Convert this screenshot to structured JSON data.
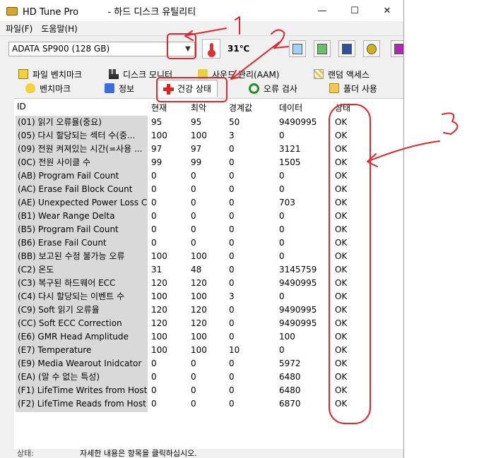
{
  "window": {
    "app_name": "HD Tune Pro",
    "subtitle": "- 하드 디스크 유틸리티",
    "minimize": "—",
    "maximize": "☐",
    "close": "✕"
  },
  "menu": [
    "파일(F)",
    "도움말(H)"
  ],
  "toolbar": {
    "drive": "ADATA SP900 (128 GB)",
    "temperature": "31℃"
  },
  "tabs_top": [
    "파일 벤치마크",
    "디스크 모니터",
    "사운드 관리(AAM)",
    "랜덤 액세스"
  ],
  "tabs_bottom": [
    "벤치마크",
    "정보",
    "건강 상태",
    "오류 검사",
    "폴더 사용"
  ],
  "columns": [
    "ID",
    "현재",
    "최악",
    "경계값",
    "데이터",
    "상태"
  ],
  "rows": [
    {
      "id": "(01) 읽기 오류율(중요)",
      "cur": "95",
      "worst": "95",
      "thr": "50",
      "data": "9490995",
      "status": "OK"
    },
    {
      "id": "(05) 다시 할당되는 섹터 수(중...",
      "cur": "100",
      "worst": "100",
      "thr": "3",
      "data": "0",
      "status": "OK"
    },
    {
      "id": "(09) 전원 켜져있는 시간(=사용 ...",
      "cur": "97",
      "worst": "97",
      "thr": "0",
      "data": "3121",
      "status": "OK"
    },
    {
      "id": "(0C) 전원 사이클 수",
      "cur": "99",
      "worst": "99",
      "thr": "0",
      "data": "1505",
      "status": "OK"
    },
    {
      "id": "(AB) Program Fail Count",
      "cur": "0",
      "worst": "0",
      "thr": "0",
      "data": "0",
      "status": "OK"
    },
    {
      "id": "(AC) Erase Fail Block Count",
      "cur": "0",
      "worst": "0",
      "thr": "0",
      "data": "0",
      "status": "OK"
    },
    {
      "id": "(AE) Unexpected Power Loss Co...",
      "cur": "0",
      "worst": "0",
      "thr": "0",
      "data": "703",
      "status": "OK"
    },
    {
      "id": "(B1) Wear Range Delta",
      "cur": "0",
      "worst": "0",
      "thr": "0",
      "data": "0",
      "status": "OK"
    },
    {
      "id": "(B5) Program Fail Count",
      "cur": "0",
      "worst": "0",
      "thr": "0",
      "data": "0",
      "status": "OK"
    },
    {
      "id": "(B6) Erase Fail Count",
      "cur": "0",
      "worst": "0",
      "thr": "0",
      "data": "0",
      "status": "OK"
    },
    {
      "id": "(BB) 보고된 수정 불가능 오류",
      "cur": "100",
      "worst": "100",
      "thr": "0",
      "data": "0",
      "status": "OK"
    },
    {
      "id": "(C2) 온도",
      "cur": "31",
      "worst": "48",
      "thr": "0",
      "data": "3145759",
      "status": "OK"
    },
    {
      "id": "(C3) 복구된 하드웨어 ECC",
      "cur": "120",
      "worst": "120",
      "thr": "0",
      "data": "9490995",
      "status": "OK"
    },
    {
      "id": "(C4) 다시 할당되는 이벤트 수",
      "cur": "100",
      "worst": "100",
      "thr": "3",
      "data": "0",
      "status": "OK"
    },
    {
      "id": "(C9) Soft 읽기 오류율",
      "cur": "120",
      "worst": "120",
      "thr": "0",
      "data": "9490995",
      "status": "OK"
    },
    {
      "id": "(CC) Soft ECC Correction",
      "cur": "120",
      "worst": "120",
      "thr": "0",
      "data": "9490995",
      "status": "OK"
    },
    {
      "id": "(E6) GMR Head Amplitude",
      "cur": "100",
      "worst": "100",
      "thr": "0",
      "data": "100",
      "status": "OK"
    },
    {
      "id": "(E7) Temperature",
      "cur": "100",
      "worst": "100",
      "thr": "10",
      "data": "0",
      "status": "OK"
    },
    {
      "id": "(E9) Media Wearout Inidcator",
      "cur": "0",
      "worst": "0",
      "thr": "0",
      "data": "5972",
      "status": "OK"
    },
    {
      "id": "(EA) (알 수 없는 특성)",
      "cur": "0",
      "worst": "0",
      "thr": "0",
      "data": "6480",
      "status": "OK"
    },
    {
      "id": "(F1) LifeTime Writes from Host",
      "cur": "0",
      "worst": "0",
      "thr": "0",
      "data": "6480",
      "status": "OK"
    },
    {
      "id": "(F2) LifeTime Reads from Host",
      "cur": "0",
      "worst": "0",
      "thr": "0",
      "data": "6870",
      "status": "OK"
    }
  ],
  "statusbar": {
    "label": "상태:",
    "message": "자세한 내용은 항목을 클릭하십시오."
  },
  "annotations": {
    "color": "#e0262f",
    "marks": [
      "1",
      "2",
      "3"
    ]
  }
}
